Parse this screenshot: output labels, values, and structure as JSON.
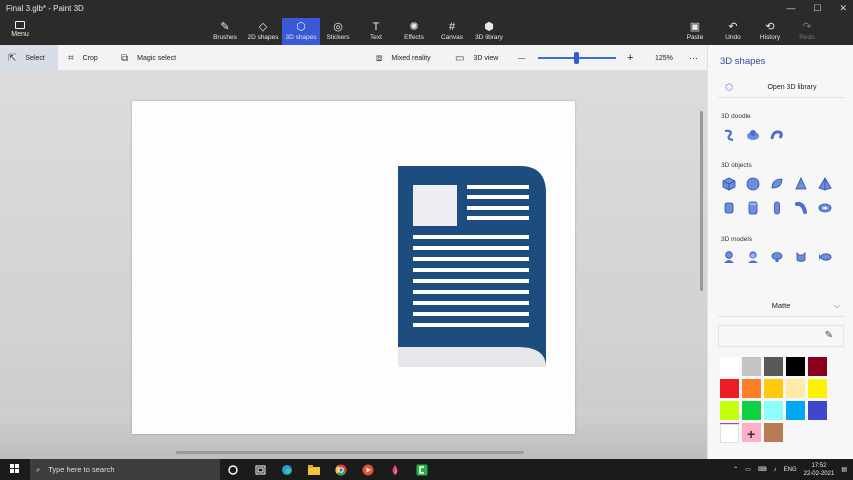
{
  "app": {
    "title": "Final 3.glb* - Paint 3D"
  },
  "window_controls": {
    "minimize": "—",
    "maximize": "☐",
    "close": "✕"
  },
  "menu": {
    "label": "Menu"
  },
  "toolbar": {
    "tools": [
      {
        "label": "Brushes",
        "icon": "brush-icon",
        "glyph": "✎"
      },
      {
        "label": "2D shapes",
        "icon": "2d-shapes-icon",
        "glyph": "◇"
      },
      {
        "label": "3D shapes",
        "icon": "3d-shapes-icon",
        "glyph": "⬡"
      },
      {
        "label": "Stickers",
        "icon": "stickers-icon",
        "glyph": "◎"
      },
      {
        "label": "Text",
        "icon": "text-icon",
        "glyph": "T"
      },
      {
        "label": "Effects",
        "icon": "effects-icon",
        "glyph": "✺"
      },
      {
        "label": "Canvas",
        "icon": "canvas-icon",
        "glyph": "#"
      },
      {
        "label": "3D library",
        "icon": "3d-library-icon",
        "glyph": "⬢"
      }
    ],
    "active_tool": "3D shapes",
    "right_tools": [
      {
        "label": "Paste",
        "icon": "paste-icon",
        "glyph": "📋"
      },
      {
        "label": "Undo",
        "icon": "undo-icon",
        "glyph": "↶"
      },
      {
        "label": "History",
        "icon": "history-icon",
        "glyph": "⟲"
      },
      {
        "label": "Redo",
        "icon": "redo-icon",
        "glyph": "↷"
      }
    ]
  },
  "subbar": {
    "select": "Select",
    "crop": "Crop",
    "magic_select": "Magic select",
    "mixed_reality": "Mixed reality",
    "view_3d": "3D view",
    "zoom_minus": "—",
    "zoom_plus": "+",
    "zoom": "125%",
    "zoom_fraction": 0.5,
    "more": "···"
  },
  "panel": {
    "title": "3D shapes",
    "open_library": "Open 3D library",
    "doodle_label": "3D doodle",
    "objects_label": "3D objects",
    "models_label": "3D models",
    "material": "Matte",
    "accent": "#4a6fd0",
    "palette": [
      "#ffffff",
      "#c3c3c3",
      "#585858",
      "#000000",
      "#88001b",
      "#ec1c24",
      "#ff7f27",
      "#ffc90e",
      "#fdeca6",
      "#fff200",
      "#c4ff0e",
      "#0ed145",
      "#8cfffb",
      "#00a8f3",
      "#3f48cc",
      "#b83dba",
      "#ffaec8",
      "#b97a56"
    ],
    "custom_color": "#ffffff",
    "add_color": "+"
  },
  "taskbar": {
    "search_placeholder": "Type here to search",
    "language": "ENG",
    "time": "17:52",
    "date": "22-02-2021"
  },
  "document_icon": {
    "color": "#1c4d7e",
    "lines": 11
  }
}
